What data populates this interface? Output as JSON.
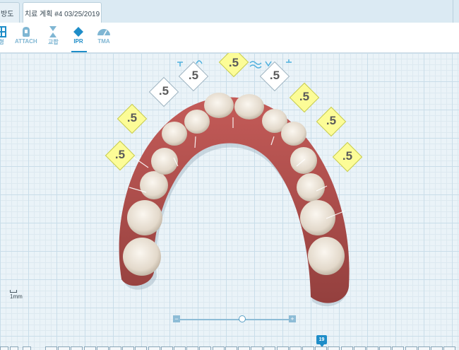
{
  "tabs": {
    "prev_label": "방도",
    "active_label": "치료 계획 #4 03/25/2019"
  },
  "toolbar": {
    "tools": [
      {
        "label": "형",
        "icon": "grid-icon"
      },
      {
        "label": "ATTACH",
        "icon": "attachment-icon"
      },
      {
        "label": "교합",
        "icon": "bite-icon"
      },
      {
        "label": "IPR",
        "icon": "ipr-diamond-icon",
        "active": true
      },
      {
        "label": "TMA",
        "icon": "tma-icon"
      }
    ]
  },
  "colors": {
    "accent": "#1e8dc8",
    "ipr_yellow": "#fcfc97",
    "gum": "#b3504d",
    "tooth": "#efe7da"
  },
  "ipr_values": [
    ".5",
    ".5",
    ".5",
    ".5",
    ".5",
    ".5",
    ".5",
    ".5",
    ".5",
    ".5"
  ],
  "scale_label": "1mm",
  "timeline": {
    "current_stage": "19"
  }
}
